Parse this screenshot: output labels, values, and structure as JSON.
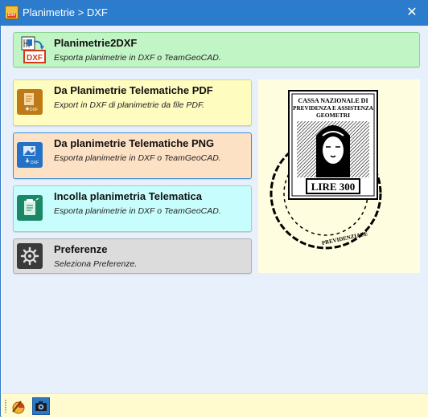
{
  "window": {
    "title": "Planimetrie > DXF",
    "close_glyph": "✕",
    "app_icon": "planimetrie-dxf-app-icon",
    "app_icon_text": "DXF"
  },
  "menu": [
    {
      "title": "Planimetrie2DXF",
      "subtitle": "Esporta planimetrie in DXF o TeamGeoCAD.",
      "icon": "planimetrie2dxf-icon",
      "color": "#c2f5c5"
    },
    {
      "title": "Da Planimetrie Telematiche PDF",
      "subtitle": "Export in DXF di planimetrie da file PDF.",
      "icon": "pdf-to-dxf-icon",
      "color": "#fffcc0"
    },
    {
      "title": "Da planimetrie Telematiche PNG",
      "subtitle": "Esporta planimetrie in DXF o TeamGeoCAD.",
      "icon": "png-to-dxf-icon",
      "color": "#fde1c4"
    },
    {
      "title": "Incolla planimetria Telematica",
      "subtitle": "Esporta planimetrie in DXF o TeamGeoCAD.",
      "icon": "clipboard-paste-icon",
      "color": "#c8fdfd"
    },
    {
      "title": "Preferenze",
      "subtitle": "Seleziona Preferenze.",
      "icon": "gear-icon",
      "color": "#dcdcdc"
    }
  ],
  "stamp": {
    "line1": "CASSA NAZIONALE DI",
    "line2": "PREVIDENZA E ASSISTENZA",
    "line3": "GEOMETRI",
    "value": "LIRE 300",
    "postmark_text": "PREVIDENZIALE"
  },
  "statusbar": {
    "buttons": [
      "pen-chart-icon",
      "camera-icon"
    ]
  }
}
